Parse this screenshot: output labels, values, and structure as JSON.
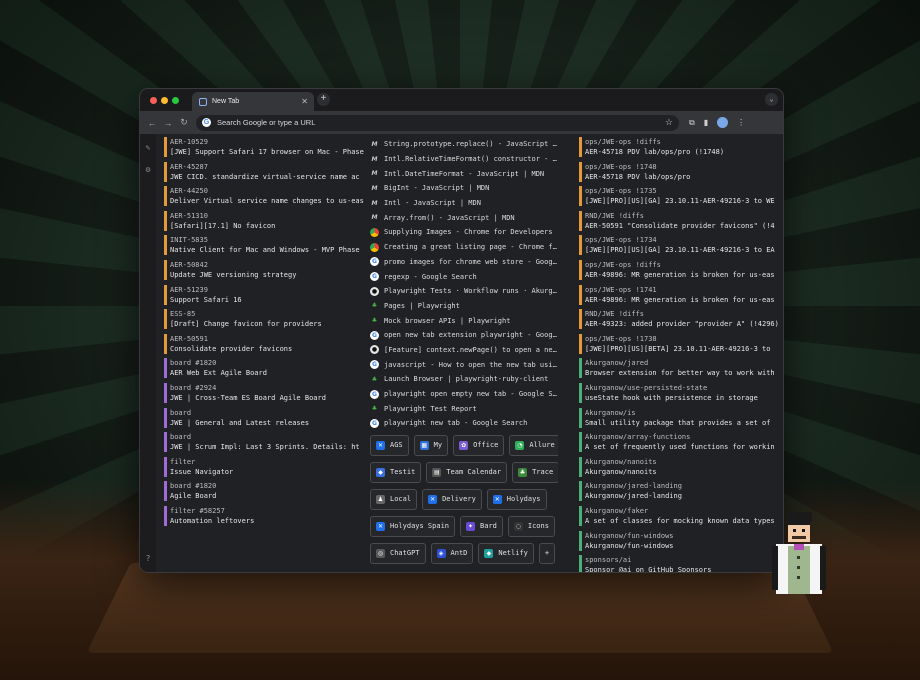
{
  "browser": {
    "tab_title": "New Tab",
    "new_tab": "+",
    "tab_menu": "⌄",
    "omnibox_placeholder": "Search Google or type a URL",
    "google_logo": "G"
  },
  "jira_items": [
    {
      "key": "AER-10529",
      "title": "[JWE] Support Safari 17 browser on Mac - Phase",
      "accent": "orange"
    },
    {
      "key": "AER-45287",
      "title": "JWE CICD. standardize virtual-service name ac",
      "accent": "orange"
    },
    {
      "key": "AER-44250",
      "title": "Deliver Virtual service name changes to us-eas",
      "accent": "orange"
    },
    {
      "key": "AER-51310",
      "title": "[Safari][17.1] No favicon",
      "accent": "orange"
    },
    {
      "key": "INIT-5835",
      "title": "Native Client for Mac and Windows - MVP Phase",
      "accent": "orange"
    },
    {
      "key": "AER-50842",
      "title": "Update JWE versioning strategy",
      "accent": "orange"
    },
    {
      "key": "AER-51239",
      "title": "Support Safari 16",
      "accent": "orange"
    },
    {
      "key": "ESS-85",
      "title": "[Draft] Change favicon for providers",
      "accent": "orange"
    },
    {
      "key": "AER-50591",
      "title": "Consolidate provider favicons",
      "accent": "orange"
    },
    {
      "key": "board #1820",
      "title": "AER Web Ext Agile Board",
      "accent": "purple"
    },
    {
      "key": "board #2924",
      "title": "JWE | Cross-Team ES Board Agile Board",
      "accent": "purple"
    },
    {
      "key": "board",
      "title": "JWE | General and Latest releases",
      "accent": "purple"
    },
    {
      "key": "board",
      "title": "JWE | Scrum Impl: Last 3 Sprints. Details: ht",
      "accent": "purple"
    },
    {
      "key": "filter",
      "title": "Issue Navigator",
      "accent": "purple"
    },
    {
      "key": "board #1820",
      "title": "Agile Board",
      "accent": "purple"
    },
    {
      "key": "filter #58257",
      "title": "Automation leftovers",
      "accent": "purple"
    }
  ],
  "links": [
    {
      "icon": "mdn",
      "text": "String.prototype.replace() - JavaScript | MDN"
    },
    {
      "icon": "mdn",
      "text": "Intl.RelativeTimeFormat() constructor - JavaScript"
    },
    {
      "icon": "mdn",
      "text": "Intl.DateTimeFormat - JavaScript | MDN"
    },
    {
      "icon": "mdn",
      "text": "BigInt - JavaScript | MDN"
    },
    {
      "icon": "mdn",
      "text": "Intl - JavaScript | MDN"
    },
    {
      "icon": "mdn",
      "text": "Array.from() - JavaScript | MDN"
    },
    {
      "icon": "chrome",
      "text": "Supplying Images - Chrome for Developers"
    },
    {
      "icon": "chrome",
      "text": "Creating a great listing page - Chrome for Developers"
    },
    {
      "icon": "google",
      "text": "promo images for chrome web store - Google Search"
    },
    {
      "icon": "google",
      "text": "regexp - Google Search"
    },
    {
      "icon": "github",
      "text": "Playwright Tests · Workflow runs · Akurganow"
    },
    {
      "icon": "pw",
      "text": "Pages | Playwright"
    },
    {
      "icon": "pw",
      "text": "Mock browser APIs | Playwright"
    },
    {
      "icon": "google",
      "text": "open new tab extension playwright - Google Search"
    },
    {
      "icon": "github",
      "text": "[Feature] context.newPage() to open a new tab"
    },
    {
      "icon": "google",
      "text": "javascript - How to open the new tab using Playwright"
    },
    {
      "icon": "pw",
      "text": "Launch Browser | playwright-ruby-client"
    },
    {
      "icon": "google",
      "text": "playwright open empty new tab - Google Search"
    },
    {
      "icon": "pw",
      "text": "Playwright Test Report"
    },
    {
      "icon": "google",
      "text": "playwright new tab - Google Search"
    }
  ],
  "quick_links": [
    [
      {
        "label": "AGS",
        "color": "#1f6feb",
        "glyph": "✕"
      },
      {
        "label": "My",
        "color": "#2f6fd6",
        "glyph": "▦"
      },
      {
        "label": "Office",
        "color": "#7b5cd6",
        "glyph": "✿"
      },
      {
        "label": "Allure",
        "color": "#2fae5a",
        "glyph": "◔"
      }
    ],
    [
      {
        "label": "Testit",
        "color": "#3a6fe0",
        "glyph": "◆"
      },
      {
        "label": "Team Calendar",
        "color": "#555",
        "glyph": "▤"
      },
      {
        "label": "Trace",
        "color": "#3c8a3c",
        "glyph": "♣"
      }
    ],
    [
      {
        "label": "Local",
        "color": "#666",
        "glyph": "♟"
      },
      {
        "label": "Delivery",
        "color": "#1f6feb",
        "glyph": "✕"
      },
      {
        "label": "Holydays",
        "color": "#1f6feb",
        "glyph": "✕"
      }
    ],
    [
      {
        "label": "Holydays Spain",
        "color": "#1f6feb",
        "glyph": "✕"
      },
      {
        "label": "Bard",
        "color": "#6a4bd6",
        "glyph": "✦"
      },
      {
        "label": "Icons",
        "color": "#333",
        "glyph": "◌"
      }
    ],
    [
      {
        "label": "ChatGPT",
        "color": "#5a5a5a",
        "glyph": "◎"
      },
      {
        "label": "AntD",
        "color": "#2f4fd6",
        "glyph": "◈"
      },
      {
        "label": "Netlify",
        "color": "#1f9e9e",
        "glyph": "◆"
      },
      {
        "label": "+",
        "color": "",
        "glyph": ""
      }
    ]
  ],
  "gitlab_items": [
    {
      "path": "ops/JWE-ops !diffs",
      "desc": "AER-45718 PDV lab/ops/pro (!1748)",
      "accent": "orange"
    },
    {
      "path": "ops/JWE-ops !1748",
      "desc": "AER-45718 PDV lab/ops/pro",
      "accent": "orange"
    },
    {
      "path": "ops/JWE-ops !1735",
      "desc": "[JWE][PRO][US][GA] 23.10.11-AER-49216-3 to WE",
      "accent": "orange"
    },
    {
      "path": "RND/JWE !diffs",
      "desc": "AER-50591 \"Consolidate provider favicons\" (!4",
      "accent": "orange"
    },
    {
      "path": "ops/JWE-ops !1734",
      "desc": "[JWE][PRO][US][GA] 23.10.11-AER-49216-3 to EA",
      "accent": "orange"
    },
    {
      "path": "ops/JWE-ops !diffs",
      "desc": "AER-49896: MR generation is broken for us-eas",
      "accent": "orange"
    },
    {
      "path": "ops/JWE-ops !1741",
      "desc": "AER-49896: MR generation is broken for us-eas",
      "accent": "orange"
    },
    {
      "path": "RND/JWE !diffs",
      "desc": "AER-49323: added provider \"provider A\" (!4296)",
      "accent": "orange"
    },
    {
      "path": "ops/JWE-ops !1738",
      "desc": "[JWE][PRO][US][BETA] 23.10.11-AER-49216-3 to",
      "accent": "orange"
    },
    {
      "path": "Akurganow/jared",
      "desc": "Browser extension for better way to work with",
      "accent": "green"
    },
    {
      "path": "Akurganow/use-persisted-state",
      "desc": "useState hook with persistence in storage",
      "accent": "green"
    },
    {
      "path": "Akurganow/is",
      "desc": "Small utility package that provides a set of",
      "accent": "green"
    },
    {
      "path": "Akurganow/array-functions",
      "desc": "A set of frequently used functions for workin",
      "accent": "green"
    },
    {
      "path": "Akurganow/nanoits",
      "desc": "Akurganow/nanoits",
      "accent": "green"
    },
    {
      "path": "Akurganow/jared-landing",
      "desc": "Akurganow/jared-landing",
      "accent": "green"
    },
    {
      "path": "Akurganow/faker",
      "desc": "A set of classes for mocking known data types",
      "accent": "green"
    },
    {
      "path": "Akurganow/fun-windows",
      "desc": "Akurganow/fun-windows",
      "accent": "green"
    },
    {
      "path": "sponsors/ai",
      "desc": "Sponsor @ai on GitHub Sponsors",
      "accent": "green"
    }
  ]
}
